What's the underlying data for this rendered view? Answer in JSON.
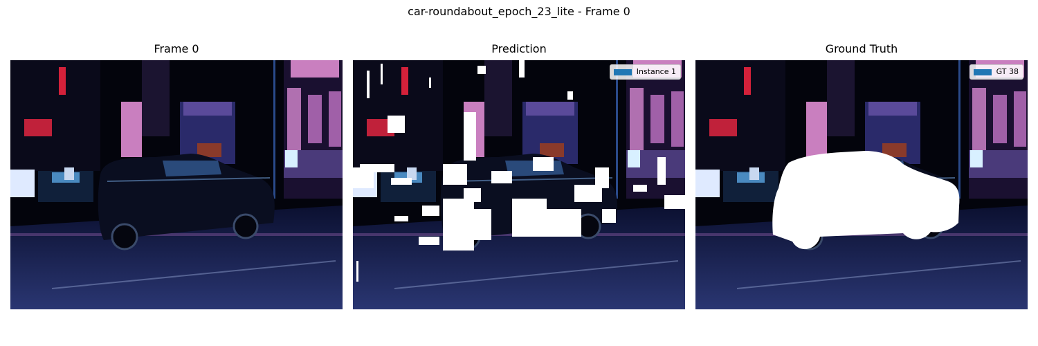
{
  "figure": {
    "title": "car-roundabout_epoch_23_lite - Frame 0"
  },
  "panels": [
    {
      "title": "Frame 0"
    },
    {
      "title": "Prediction",
      "legend": {
        "label": "Instance 1",
        "color": "#1f77b4"
      }
    },
    {
      "title": "Ground Truth",
      "legend": {
        "label": "GT 38",
        "color": "#1f77b4"
      }
    }
  ],
  "colors": {
    "mask": "#ffffff",
    "sky_dark": "#02030a",
    "road": "#1a2350",
    "building_pink": "#c97fbf",
    "sign_red": "#d4213a"
  }
}
